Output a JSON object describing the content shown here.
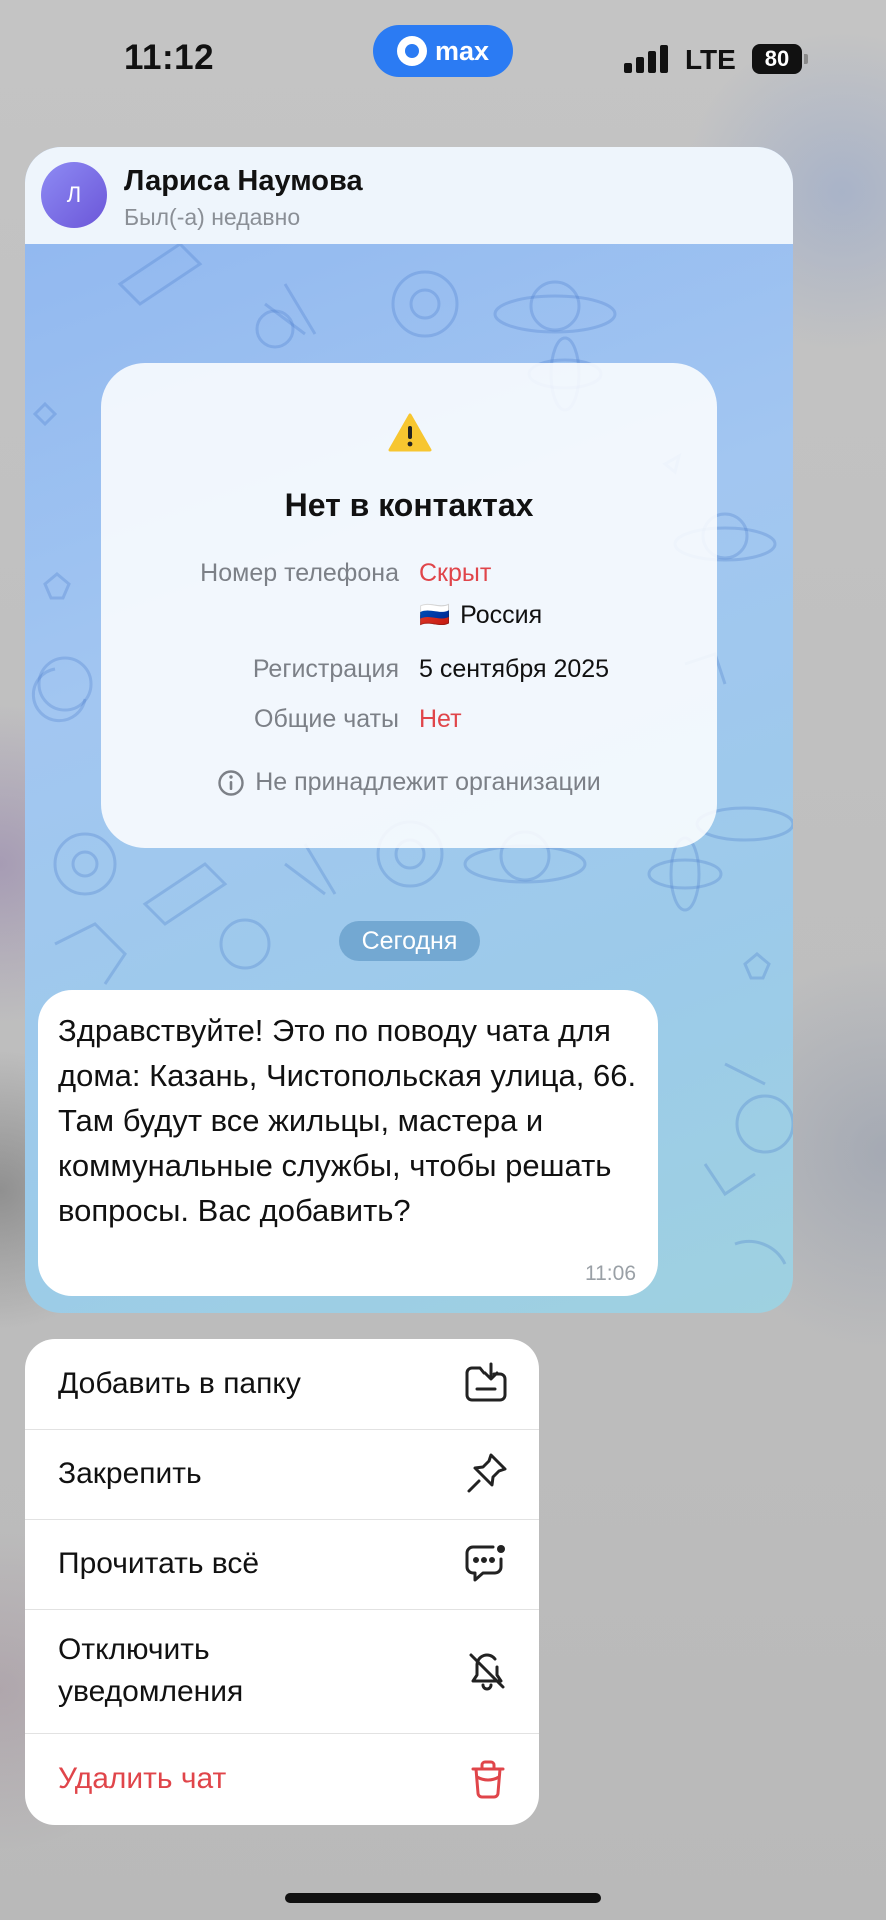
{
  "status_bar": {
    "time": "11:12",
    "app_badge": "max",
    "network": "LTE",
    "battery": "80"
  },
  "chat": {
    "contact_name": "Лариса Наумова",
    "contact_status": "Был(-а) недавно",
    "avatar_letter": "Л",
    "info_card": {
      "title": "Нет в контактах",
      "phone_label": "Номер телефона",
      "phone_value": "Скрыт",
      "country_flag": "🇷🇺",
      "country": "Россия",
      "registration_label": "Регистрация",
      "registration_value": "5 сентября 2025",
      "common_chats_label": "Общие чаты",
      "common_chats_value": "Нет",
      "org_note": "Не принадлежит организации"
    },
    "date_separator": "Сегодня",
    "message": {
      "text": "Здравствуйте! Это по поводу чата для дома: Казань, Чистопольская улица, 66. Там будут все жильцы, мастера и коммунальные службы, чтобы решать вопросы. Вас добавить?",
      "time": "11:06"
    }
  },
  "menu": {
    "add_to_folder": "Добавить в папку",
    "pin": "Закрепить",
    "read_all": "Прочитать всё",
    "mute_line1": "Отключить",
    "mute_line2": "уведомления",
    "delete": "Удалить чат"
  },
  "colors": {
    "accent": "#2b7bf3",
    "danger": "#e0454a",
    "warning": "#f7c630"
  }
}
